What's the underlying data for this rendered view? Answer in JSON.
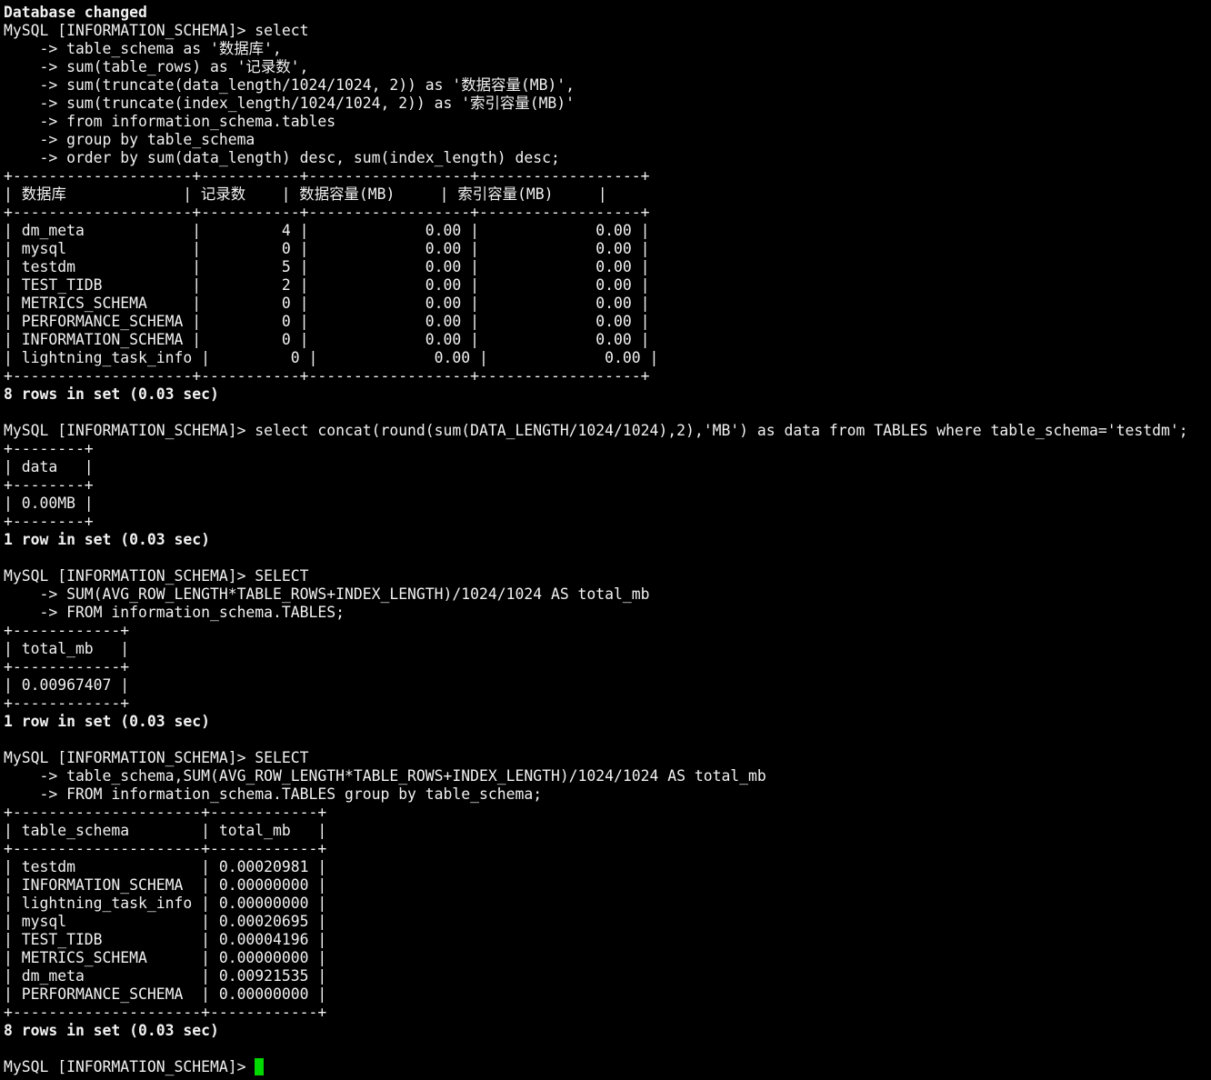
{
  "colors": {
    "background": "#000000",
    "foreground": "#f2f2f2",
    "cursor": "#00d800"
  },
  "prompt": "MySQL [INFORMATION_SCHEMA]> ",
  "lines": [
    {
      "text": "Database changed",
      "bold": true
    },
    {
      "text": "MySQL [INFORMATION_SCHEMA]> select"
    },
    {
      "text": "    -> table_schema as '数据库',"
    },
    {
      "text": "    -> sum(table_rows) as '记录数',"
    },
    {
      "text": "    -> sum(truncate(data_length/1024/1024, 2)) as '数据容量(MB)',"
    },
    {
      "text": "    -> sum(truncate(index_length/1024/1024, 2)) as '索引容量(MB)'"
    },
    {
      "text": "    -> from information_schema.tables"
    },
    {
      "text": "    -> group by table_schema"
    },
    {
      "text": "    -> order by sum(data_length) desc, sum(index_length) desc;"
    },
    {
      "text": "+--------------------+-----------+------------------+------------------+"
    },
    {
      "text": "| 数据库             | 记录数    | 数据容量(MB)     | 索引容量(MB)     |"
    },
    {
      "text": "+--------------------+-----------+------------------+------------------+"
    },
    {
      "text": "| dm_meta            |         4 |             0.00 |             0.00 |"
    },
    {
      "text": "| mysql              |         0 |             0.00 |             0.00 |"
    },
    {
      "text": "| testdm             |         5 |             0.00 |             0.00 |"
    },
    {
      "text": "| TEST_TIDB          |         2 |             0.00 |             0.00 |"
    },
    {
      "text": "| METRICS_SCHEMA     |         0 |             0.00 |             0.00 |"
    },
    {
      "text": "| PERFORMANCE_SCHEMA |         0 |             0.00 |             0.00 |"
    },
    {
      "text": "| INFORMATION_SCHEMA |         0 |             0.00 |             0.00 |"
    },
    {
      "text": "| lightning_task_info |         0 |             0.00 |             0.00 |"
    },
    {
      "text": "+--------------------+-----------+------------------+------------------+"
    },
    {
      "text": "8 rows in set (0.03 sec)",
      "bold": true
    },
    {
      "text": ""
    },
    {
      "text": "MySQL [INFORMATION_SCHEMA]> select concat(round(sum(DATA_LENGTH/1024/1024),2),'MB') as data from TABLES where table_schema='testdm';"
    },
    {
      "text": "+--------+"
    },
    {
      "text": "| data   |"
    },
    {
      "text": "+--------+"
    },
    {
      "text": "| 0.00MB |"
    },
    {
      "text": "+--------+"
    },
    {
      "text": "1 row in set (0.03 sec)",
      "bold": true
    },
    {
      "text": ""
    },
    {
      "text": "MySQL [INFORMATION_SCHEMA]> SELECT"
    },
    {
      "text": "    -> SUM(AVG_ROW_LENGTH*TABLE_ROWS+INDEX_LENGTH)/1024/1024 AS total_mb"
    },
    {
      "text": "    -> FROM information_schema.TABLES;"
    },
    {
      "text": "+------------+"
    },
    {
      "text": "| total_mb   |"
    },
    {
      "text": "+------------+"
    },
    {
      "text": "| 0.00967407 |"
    },
    {
      "text": "+------------+"
    },
    {
      "text": "1 row in set (0.03 sec)",
      "bold": true
    },
    {
      "text": ""
    },
    {
      "text": "MySQL [INFORMATION_SCHEMA]> SELECT"
    },
    {
      "text": "    -> table_schema,SUM(AVG_ROW_LENGTH*TABLE_ROWS+INDEX_LENGTH)/1024/1024 AS total_mb"
    },
    {
      "text": "    -> FROM information_schema.TABLES group by table_schema;"
    },
    {
      "text": "+---------------------+------------+"
    },
    {
      "text": "| table_schema        | total_mb   |"
    },
    {
      "text": "+---------------------+------------+"
    },
    {
      "text": "| testdm              | 0.00020981 |"
    },
    {
      "text": "| INFORMATION_SCHEMA  | 0.00000000 |"
    },
    {
      "text": "| lightning_task_info | 0.00000000 |"
    },
    {
      "text": "| mysql               | 0.00020695 |"
    },
    {
      "text": "| TEST_TIDB           | 0.00004196 |"
    },
    {
      "text": "| METRICS_SCHEMA      | 0.00000000 |"
    },
    {
      "text": "| dm_meta             | 0.00921535 |"
    },
    {
      "text": "| PERFORMANCE_SCHEMA  | 0.00000000 |"
    },
    {
      "text": "+---------------------+------------+"
    },
    {
      "text": "8 rows in set (0.03 sec)",
      "bold": true
    },
    {
      "text": ""
    }
  ]
}
